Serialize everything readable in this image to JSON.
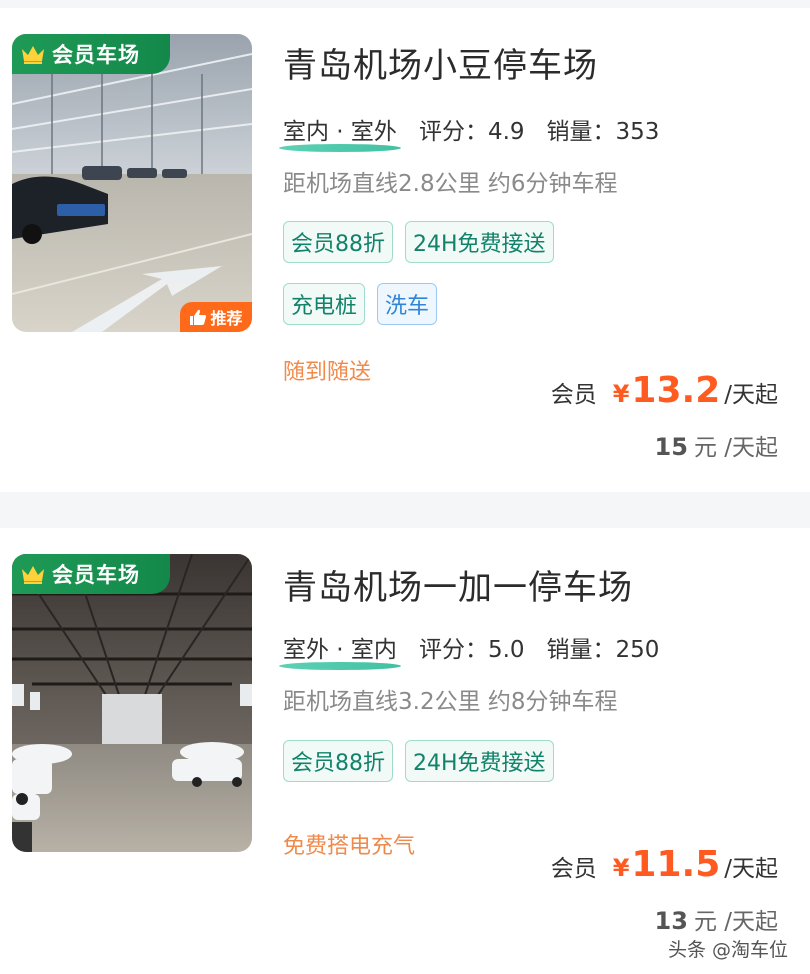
{
  "listings": [
    {
      "title": "青岛机场小豆停车场",
      "member_badge": "会员车场",
      "recommend_badge": "推荐",
      "indoor_outdoor": "室内 · 室外",
      "rating_label": "评分：",
      "rating": "4.9",
      "sales_label": "销量：",
      "sales": "353",
      "distance": "距机场直线2.8公里 约6分钟车程",
      "tags_row1": [
        "会员88折",
        "24H免费接送"
      ],
      "tags_row2": [
        "充电桩",
        "洗车"
      ],
      "promo": "随到随送",
      "member_label": "会员",
      "currency": "¥",
      "member_price": "13.2",
      "price_unit": "/天起",
      "original_price": "15",
      "original_unit": "元 /天起"
    },
    {
      "title": "青岛机场一加一停车场",
      "member_badge": "会员车场",
      "indoor_outdoor": "室外 · 室内",
      "rating_label": "评分：",
      "rating": "5.0",
      "sales_label": "销量：",
      "sales": "250",
      "distance": "距机场直线3.2公里 约8分钟车程",
      "tags_row1": [
        "会员88折",
        "24H免费接送"
      ],
      "promo": "免费搭电充气",
      "member_label": "会员",
      "currency": "¥",
      "member_price": "11.5",
      "price_unit": "/天起",
      "original_price": "13",
      "original_unit": "元 /天起"
    }
  ],
  "watermark": "头条 @淘车位",
  "colors": {
    "member_badge": "#1f9a56",
    "price": "#ff5a1f",
    "promo": "#f08a4b",
    "tag_green": "#12826a",
    "tag_blue": "#2f86d8",
    "recommend_badge": "#ff6a1a"
  },
  "icons": {
    "member_badge": "crown-icon",
    "recommend_badge": "thumbs-up-icon"
  }
}
